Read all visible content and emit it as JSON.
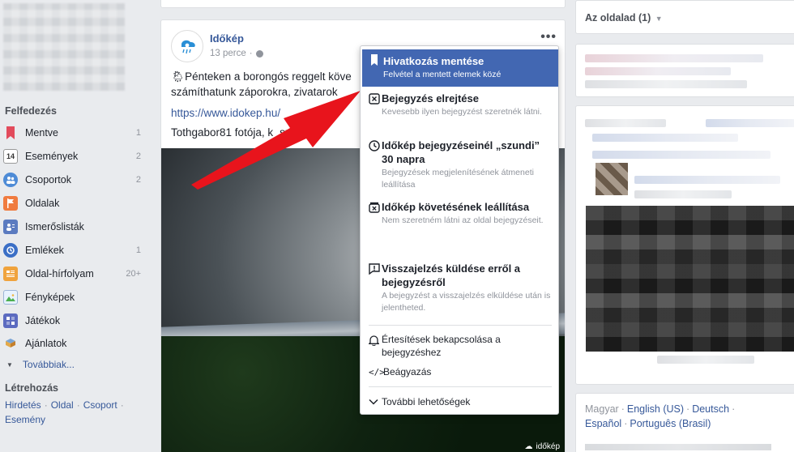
{
  "sidebar": {
    "explore_title": "Felfedezés",
    "items": [
      {
        "label": "Mentve",
        "count": "1",
        "icon": "bookmark-icon",
        "color": "#e24b5c"
      },
      {
        "label": "Események",
        "count": "2",
        "icon": "calendar-icon",
        "color": "#e9ebee"
      },
      {
        "label": "Csoportok",
        "count": "2",
        "icon": "groups-icon",
        "color": "#4e8bd6"
      },
      {
        "label": "Oldalak",
        "count": "",
        "icon": "flag-icon",
        "color": "#f07b3f"
      },
      {
        "label": "Ismerőslisták",
        "count": "",
        "icon": "friend-list-icon",
        "color": "#5b7bc0"
      },
      {
        "label": "Emlékek",
        "count": "1",
        "icon": "memories-icon",
        "color": "#3b6fc6"
      },
      {
        "label": "Oldal-hírfolyam",
        "count": "20+",
        "icon": "page-feed-icon",
        "color": "#f0a33d"
      },
      {
        "label": "Fényképek",
        "count": "",
        "icon": "photos-icon",
        "color": "#4caf50"
      },
      {
        "label": "Játékok",
        "count": "",
        "icon": "games-icon",
        "color": "#5c6bc0"
      },
      {
        "label": "Ajánlatok",
        "count": "",
        "icon": "offers-icon",
        "color": "#7aa5d6"
      }
    ],
    "more_label": "Továbbiak...",
    "create_title": "Létrehozás",
    "create_links": [
      "Hirdetés",
      "Oldal",
      "Csoport",
      "Esemény"
    ]
  },
  "post": {
    "author": "Időkép",
    "time": "13 perce",
    "text_line1": "Pénteken a borongós reggelt köve",
    "text_line2": "számíthatunk záporokra, zivatarok",
    "link": "https://www.idokep.hu/",
    "credit": "Tothgabor81 fotója, k",
    "credit_tail": "szönjük!",
    "watermark": "időkép"
  },
  "menu": {
    "items": [
      {
        "title": "Hivatkozás mentése",
        "sub": "Felvétel a mentett elemek közé",
        "icon": "bookmark-icon"
      },
      {
        "title": "Bejegyzés elrejtése",
        "sub": "Kevesebb ilyen bejegyzést szeretnék látni.",
        "icon": "hide-icon"
      },
      {
        "title": "Időkép bejegyzéseinél „szundi” 30 napra",
        "sub": "Bejegyzések megjelenítésének átmeneti leállítása",
        "icon": "clock-icon"
      },
      {
        "title": "Időkép követésének leállítása",
        "sub": "Nem szeretném látni az oldal bejegyzéseit.",
        "icon": "unfollow-icon"
      },
      {
        "title": "Visszajelzés küldése erről a bejegyzésről",
        "sub": "A bejegyzést a visszajelzés elküldése után is jelentheted.",
        "icon": "report-icon"
      }
    ],
    "notify": "Értesítések bekapcsolása a bejegyzéshez",
    "embed": "Beágyazás",
    "more": "További lehetőségek"
  },
  "right": {
    "page_selector": "Az oldalad (1)",
    "languages": {
      "current": "Magyar",
      "others": [
        "English (US)",
        "Deutsch",
        "Español",
        "Português (Brasil)"
      ]
    }
  },
  "colors": {
    "accent": "#4267b2",
    "link": "#365899",
    "arrow": "#e8141c"
  }
}
